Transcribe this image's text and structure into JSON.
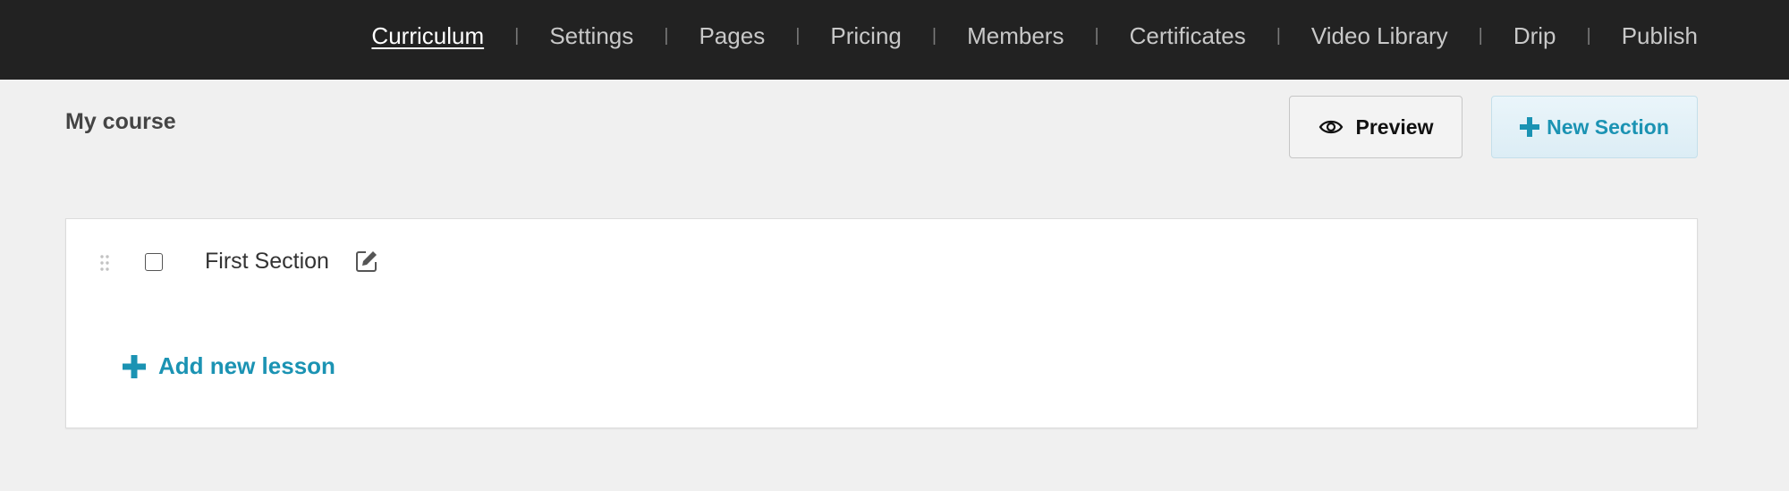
{
  "nav": {
    "items": [
      {
        "label": "Curriculum",
        "active": true
      },
      {
        "label": "Settings"
      },
      {
        "label": "Pages"
      },
      {
        "label": "Pricing"
      },
      {
        "label": "Members"
      },
      {
        "label": "Certificates"
      },
      {
        "label": "Video Library"
      },
      {
        "label": "Drip"
      },
      {
        "label": "Publish"
      }
    ],
    "separator": "|"
  },
  "course": {
    "title": "My course"
  },
  "toolbar": {
    "preview_label": "Preview",
    "preview_icon": "eye-icon",
    "new_section_label": "New Section",
    "new_section_icon": "plus-icon"
  },
  "section": {
    "name": "First Section",
    "checked": false,
    "edit_icon": "edit-icon",
    "drag_icon": "drag-handle-icon",
    "add_lesson_label": "Add new lesson",
    "add_lesson_icon": "plus-icon"
  },
  "colors": {
    "nav_bg": "#222222",
    "page_bg": "#f0f0f0",
    "accent": "#1b93b3"
  }
}
